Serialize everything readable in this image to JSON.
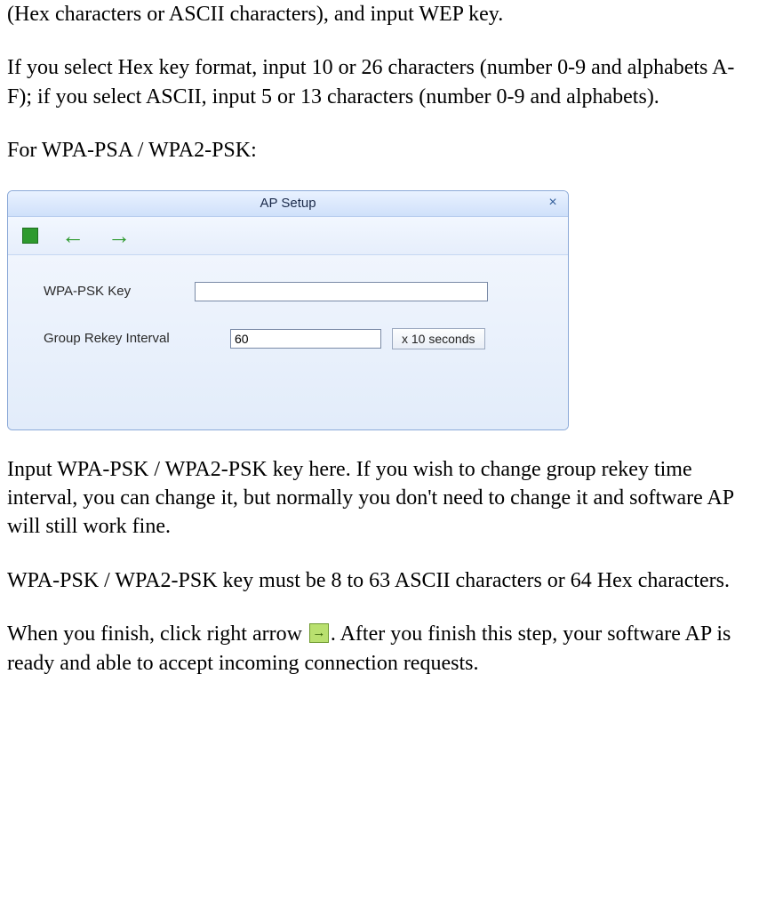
{
  "paragraphs": {
    "p1": "(Hex characters or ASCII characters), and input WEP key.",
    "p2": "If you select Hex key format, input 10 or 26 characters (number 0-9 and alphabets A-F); if you select ASCII, input 5 or 13 characters (number 0-9 and alphabets).",
    "p3": "For WPA-PSA / WPA2-PSK:",
    "p4": "Input WPA-PSK / WPA2-PSK key here. If you wish to change group rekey time interval, you can change it, but normally you don't need to change it and software AP will still work fine.",
    "p5": "WPA-PSK / WPA2-PSK key must be 8 to 63 ASCII characters or 64 Hex characters.",
    "p6a": "When you finish, click right arrow ",
    "p6b": ". After you finish this step, your software AP is ready and able to accept incoming connection requests."
  },
  "dialog": {
    "title": "AP Setup",
    "close": "×",
    "wpa_label": "WPA-PSK Key",
    "wpa_value": "",
    "rekey_label": "Group Rekey Interval",
    "rekey_value": "60",
    "rekey_unit_btn": "x 10 seconds"
  }
}
